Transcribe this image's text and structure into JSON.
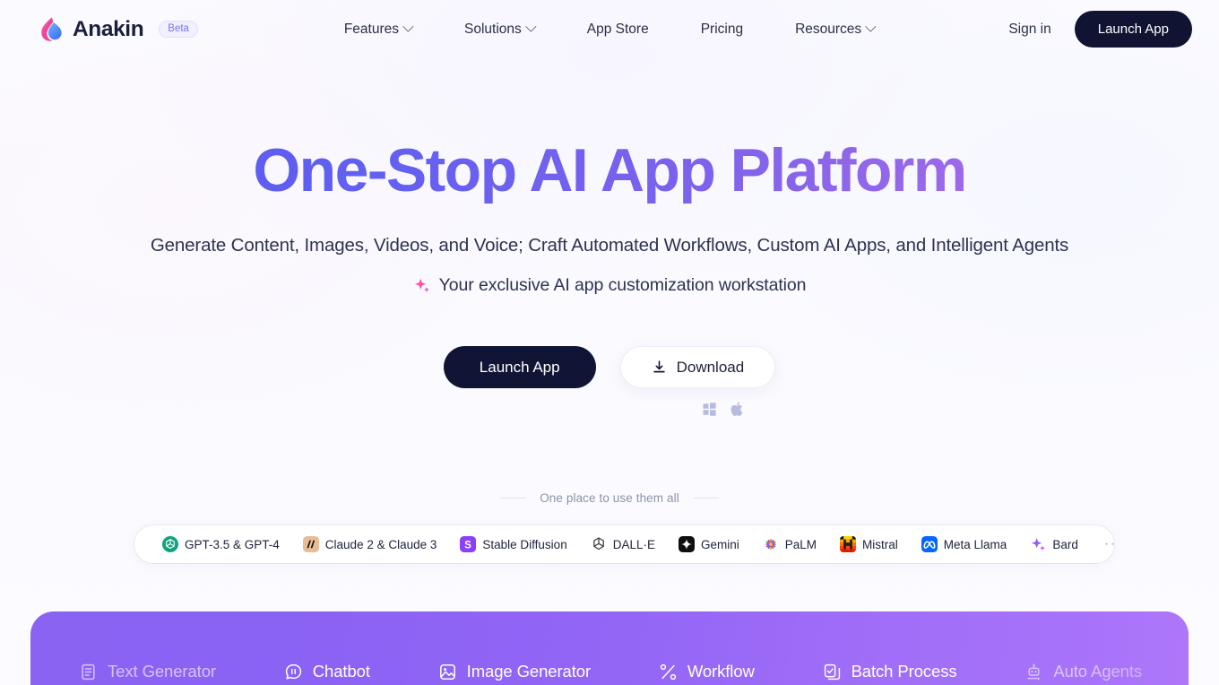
{
  "brand": {
    "name": "Anakin",
    "badge": "Beta",
    "logo_icon": "flame-logo-icon",
    "logo_colors": {
      "outer": "#f0439a",
      "inner": "#3d8bf5"
    }
  },
  "nav": {
    "items": [
      {
        "label": "Features",
        "has_dropdown": true,
        "icon": "chevron-down-icon"
      },
      {
        "label": "Solutions",
        "has_dropdown": true,
        "icon": "chevron-down-icon"
      },
      {
        "label": "App Store",
        "has_dropdown": false,
        "icon": ""
      },
      {
        "label": "Pricing",
        "has_dropdown": false,
        "icon": ""
      },
      {
        "label": "Resources",
        "has_dropdown": true,
        "icon": "chevron-down-icon"
      }
    ],
    "sign_in": "Sign in",
    "launch_app": "Launch App"
  },
  "hero": {
    "title": "One-Stop AI App Platform",
    "title_gradient_from": "#5758ef",
    "title_gradient_to": "#b070e6",
    "subtitle": "Generate Content, Images, Videos, and Voice; Craft Automated Workflows, Custom AI Apps, and Intelligent Agents",
    "tagline": "Your exclusive AI app customization workstation",
    "tagline_icon": "sparkle-icon",
    "primary_cta": "Launch App",
    "secondary_cta": "Download",
    "secondary_cta_icon": "download-icon",
    "platforms": [
      {
        "name": "windows-icon",
        "label": "Windows"
      },
      {
        "name": "apple-icon",
        "label": "macOS"
      }
    ]
  },
  "models": {
    "divider_label": "One place to use them all",
    "more_label": "···",
    "chips": [
      {
        "label": "GPT-3.5 & GPT-4",
        "icon": "openai-icon",
        "color": "#10a37f"
      },
      {
        "label": "Claude 2 & Claude 3",
        "icon": "claude-icon",
        "color": "#e8bc97"
      },
      {
        "label": "Stable Diffusion",
        "icon": "stable-diffusion-icon",
        "color": "#8a3ffc"
      },
      {
        "label": "DALL·E",
        "icon": "dalle-icon",
        "color": "#3f3f46"
      },
      {
        "label": "Gemini",
        "icon": "gemini-icon",
        "color": "#0f0f12"
      },
      {
        "label": "PaLM",
        "icon": "palm-icon",
        "color": "#f2a03d"
      },
      {
        "label": "Mistral",
        "icon": "mistral-icon",
        "color": "#f54e00"
      },
      {
        "label": "Meta Llama",
        "icon": "meta-llama-icon",
        "color": "#0866ff"
      },
      {
        "label": "Bard",
        "icon": "bard-icon",
        "color": "#8e5cf7"
      }
    ]
  },
  "feature_bar": {
    "background_from": "#8b63f3",
    "background_to": "#ab75fa",
    "items": [
      {
        "label": "Text Generator",
        "icon": "document-text-icon",
        "dim": true
      },
      {
        "label": "Chatbot",
        "icon": "chat-bubble-icon",
        "dim": false
      },
      {
        "label": "Image Generator",
        "icon": "image-icon",
        "dim": false
      },
      {
        "label": "Workflow",
        "icon": "workflow-nodes-icon",
        "dim": false
      },
      {
        "label": "Batch Process",
        "icon": "batch-copy-check-icon",
        "dim": false
      },
      {
        "label": "Auto Agents",
        "icon": "auto-agent-icon",
        "dim": true
      }
    ]
  }
}
